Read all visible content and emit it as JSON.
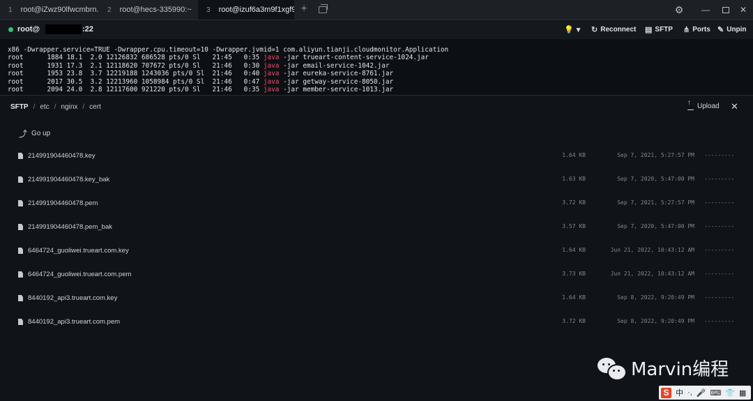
{
  "tabs": [
    {
      "num": "1",
      "title": "root@iZwz90lfwcmbrn..."
    },
    {
      "num": "2",
      "title": "root@hecs-335990:~"
    },
    {
      "num": "3",
      "title": "root@izuf6a3m9f1xgf9..."
    }
  ],
  "window": {
    "plus": "+",
    "gear": "⚙",
    "min": "—",
    "close": "✕"
  },
  "session": {
    "user": "root@",
    "port": ":22",
    "actions": {
      "bulb_icon": "💡",
      "reconnect_icon": "↻",
      "reconnect": "Reconnect",
      "sftp_icon": "▤",
      "sftp": "SFTP",
      "ports_icon": "⋔",
      "ports": "Ports",
      "unpin_icon": "✎",
      "unpin": "Unpin"
    },
    "status_color": "#38c172"
  },
  "terminal": {
    "header": "x86 -Dwrapper.service=TRUE -Dwrapper.cpu.timeout=10 -Dwrapper.jvmid=1 com.aliyun.tianji.cloudmonitor.Application",
    "lines": [
      {
        "pre": "root      1884 18.1  2.0 12126832 686528 pts/0 Sl   21:45   0:35 ",
        "java": "java",
        "post": " -jar trueart-content-service-1024.jar"
      },
      {
        "pre": "root      1931 17.3  2.1 12118620 707672 pts/0 Sl   21:46   0:30 ",
        "java": "java",
        "post": " -jar email-service-1042.jar"
      },
      {
        "pre": "root      1953 23.8  3.7 12219188 1243036 pts/0 Sl  21:46   0:40 ",
        "java": "java",
        "post": " -jar eureka-service-8761.jar"
      },
      {
        "pre": "root      2017 30.5  3.2 12213960 1058984 pts/0 Sl  21:46   0:47 ",
        "java": "java",
        "post": " -jar getway-service-8050.jar"
      },
      {
        "pre": "root      2094 24.0  2.8 12117600 921220 pts/0 Sl   21:46   0:35 ",
        "java": "java",
        "post": " -jar member-service-1013.jar"
      }
    ],
    "java_color": "#ef4f6a"
  },
  "sftp": {
    "breadcrumb": {
      "root": "SFTP",
      "sep": "/",
      "parts": [
        "etc",
        "nginx",
        "cert"
      ]
    },
    "upload": "Upload",
    "close": "✕",
    "goup_icon": "⤴",
    "goup": "Go up",
    "files": [
      {
        "name": "214991904460478.key",
        "size": "1.64 KB",
        "date": "Sep 7, 2021, 5:27:57 PM",
        "perm": "---------"
      },
      {
        "name": "214991904460478.key_bak",
        "size": "1.63 KB",
        "date": "Sep 7, 2020, 5:47:00 PM",
        "perm": "---------"
      },
      {
        "name": "214991904460478.pem",
        "size": "3.72 KB",
        "date": "Sep 7, 2021, 5:27:57 PM",
        "perm": "---------"
      },
      {
        "name": "214991904460478.pem_bak",
        "size": "3.57 KB",
        "date": "Sep 7, 2020, 5:47:00 PM",
        "perm": "---------"
      },
      {
        "name": "6464724_guoliwei.trueart.com.key",
        "size": "1.64 KB",
        "date": "Jun 21, 2022, 10:43:12 AM",
        "perm": "---------"
      },
      {
        "name": "6464724_guoliwei.trueart.com.pem",
        "size": "3.73 KB",
        "date": "Jun 21, 2022, 10:43:12 AM",
        "perm": "---------"
      },
      {
        "name": "8440192_api3.trueart.com.key",
        "size": "1.64 KB",
        "date": "Sep 8, 2022, 9:20:49 PM",
        "perm": "---------"
      },
      {
        "name": "8440192_api3.trueart.com.pem",
        "size": "3.72 KB",
        "date": "Sep 8, 2022, 9:20:49 PM",
        "perm": "---------"
      }
    ]
  },
  "watermark": "Marvin编程",
  "ime": {
    "logo": "S",
    "items": [
      "中",
      "·,",
      "🎤",
      "⌨",
      "👕",
      "▦"
    ]
  }
}
